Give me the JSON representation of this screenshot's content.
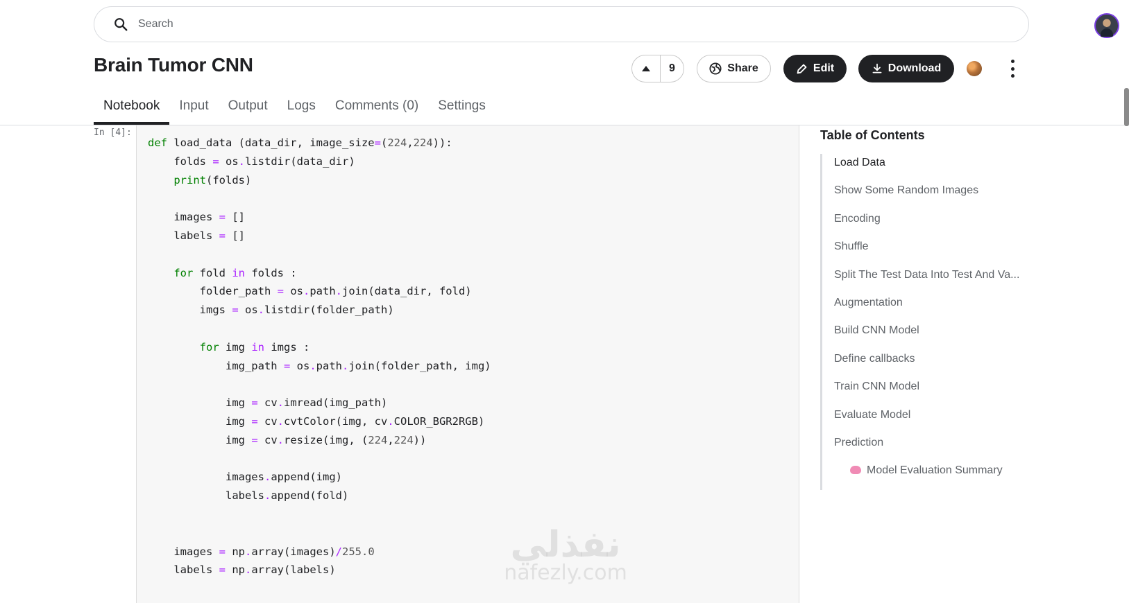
{
  "header": {
    "search_placeholder": "Search",
    "title": "Brain Tumor CNN",
    "vote_count": "9",
    "share_label": "Share",
    "edit_label": "Edit",
    "download_label": "Download"
  },
  "tabs": [
    {
      "label": "Notebook",
      "active": true
    },
    {
      "label": "Input"
    },
    {
      "label": "Output"
    },
    {
      "label": "Logs"
    },
    {
      "label": "Comments (0)"
    },
    {
      "label": "Settings"
    }
  ],
  "cell": {
    "prompt": "In [4]:"
  },
  "watermark": {
    "arabic": "نفذلي",
    "latin": "nafezly.com"
  },
  "toc": {
    "title": "Table of Contents",
    "items": [
      "Load Data",
      "Show Some Random Images",
      "Encoding",
      "Shuffle",
      "Split The Test Data Into Test And Va...",
      "Augmentation",
      "Build CNN Model",
      "Define callbacks",
      "Train CNN Model",
      "Evaluate Model",
      "Prediction",
      "Model Evaluation Summary"
    ]
  },
  "colors": {
    "primary_button": "#202124",
    "avatar_ring": "#7b3fe4",
    "keyword": "#008000",
    "operator": "#aa22ff"
  }
}
